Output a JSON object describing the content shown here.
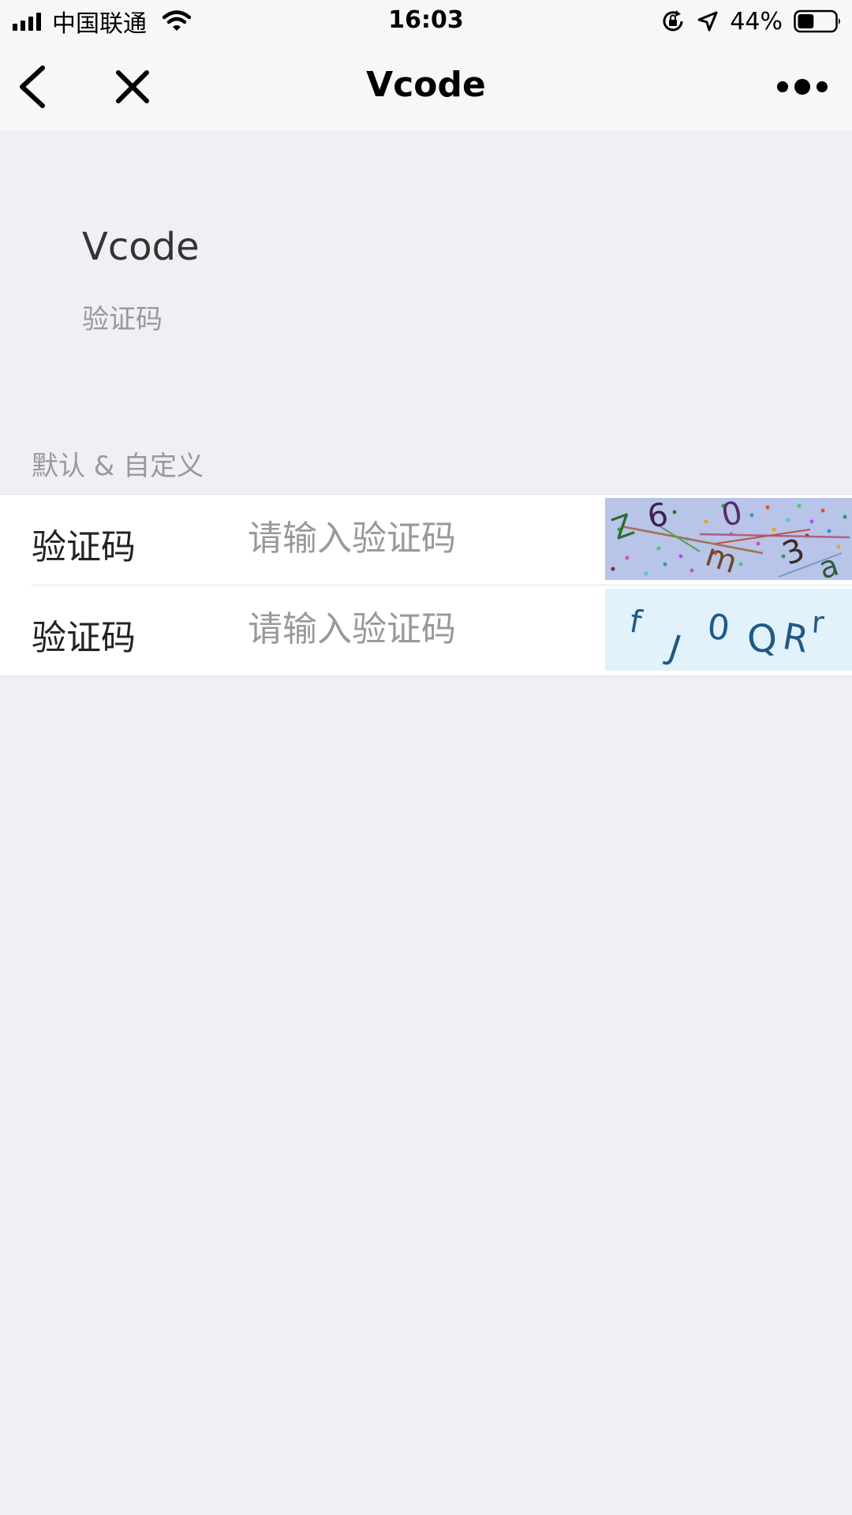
{
  "status_bar": {
    "carrier": "中国联通",
    "time": "16:03",
    "battery_percent": "44%",
    "battery_level": 0.44,
    "icons": [
      "signal-icon",
      "wifi-icon",
      "orientation-lock-icon",
      "location-icon",
      "battery-icon"
    ]
  },
  "nav": {
    "title": "Vcode",
    "icons": [
      "back-icon",
      "close-icon",
      "more-icon"
    ]
  },
  "page": {
    "title": "Vcode",
    "desc": "验证码"
  },
  "section": {
    "title": "默认 & 自定义"
  },
  "cells": [
    {
      "label": "验证码",
      "placeholder": "请输入验证码",
      "value": "",
      "captcha": {
        "chars": [
          "Z",
          "6",
          "0",
          "m",
          "3",
          "a"
        ],
        "background": "#b8c4e8"
      }
    },
    {
      "label": "验证码",
      "placeholder": "请输入验证码",
      "value": "",
      "captcha": {
        "chars": [
          "f",
          "J",
          "0",
          "Q",
          "R",
          "r"
        ],
        "background": "#e1f2fb"
      }
    }
  ]
}
